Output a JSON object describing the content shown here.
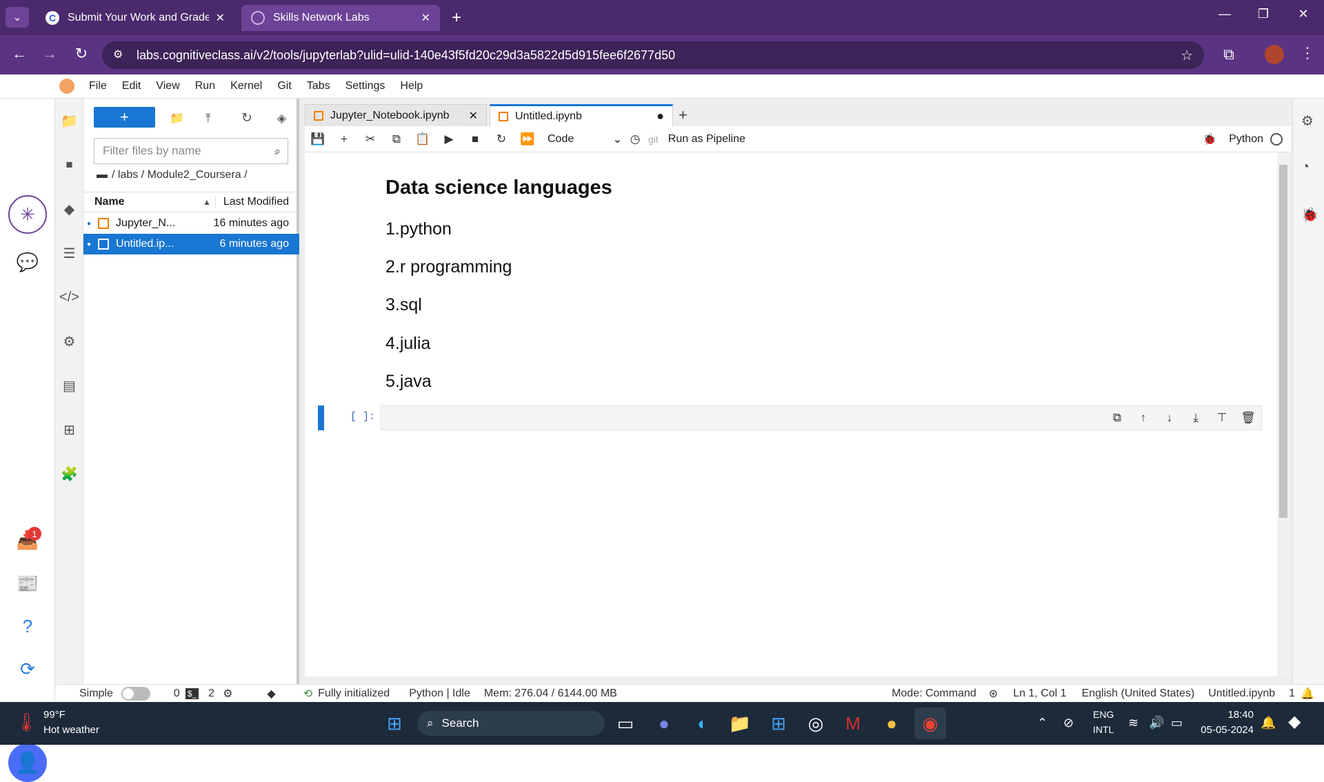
{
  "browser": {
    "tabs": [
      {
        "label": "Submit Your Work and Grade Y",
        "favicon": "C"
      },
      {
        "label": "Skills Network Labs"
      }
    ],
    "url": "labs.cognitiveclass.ai/v2/tools/jupyterlab?ulid=ulid-140e43f5fd20c29d3a5822d5d915fee6f2677d50"
  },
  "menubar": [
    "File",
    "Edit",
    "View",
    "Run",
    "Kernel",
    "Git",
    "Tabs",
    "Settings",
    "Help"
  ],
  "filebrowser": {
    "new_label": "+",
    "filter_placeholder": "Filter files by name",
    "breadcrumb": "/ labs / Module2_Coursera /",
    "col_name": "Name",
    "col_modified": "Last Modified",
    "files": [
      {
        "name": "Jupyter_N...",
        "modified": "16 minutes ago"
      },
      {
        "name": "Untitled.ip...",
        "modified": "6 minutes ago"
      }
    ]
  },
  "notebook": {
    "tabs": [
      {
        "label": "Jupyter_Notebook.ipynb"
      },
      {
        "label": "Untitled.ipynb"
      }
    ],
    "cell_type": "Code",
    "git_label": "git",
    "pipeline_label": "Run as Pipeline",
    "kernel_name": "Python",
    "markdown_heading": "Data science languages",
    "markdown_items": [
      "1.python",
      "2.r programming",
      "3.sql",
      "4.julia",
      "5.java"
    ],
    "prompt": "[ ]:"
  },
  "status": {
    "mode_simple": "Simple",
    "count_a": "0",
    "count_b": "2",
    "init": "Fully initialized",
    "kernel": "Python | Idle",
    "mem": "Mem: 276.04 / 6144.00 MB",
    "mode": "Mode: Command",
    "position": "Ln 1, Col 1",
    "language": "English (United States)",
    "file": "Untitled.ipynb",
    "notif_count": "1"
  },
  "sidebar": {
    "badge": "1"
  },
  "taskbar": {
    "weather_temp": "99°F",
    "weather_desc": "Hot weather",
    "search": "Search",
    "lang1": "ENG",
    "lang2": "INTL",
    "time": "18:40",
    "date": "05-05-2024"
  },
  "colors": {
    "accent": "#1976d2",
    "chrome": "#4a2a6c"
  }
}
